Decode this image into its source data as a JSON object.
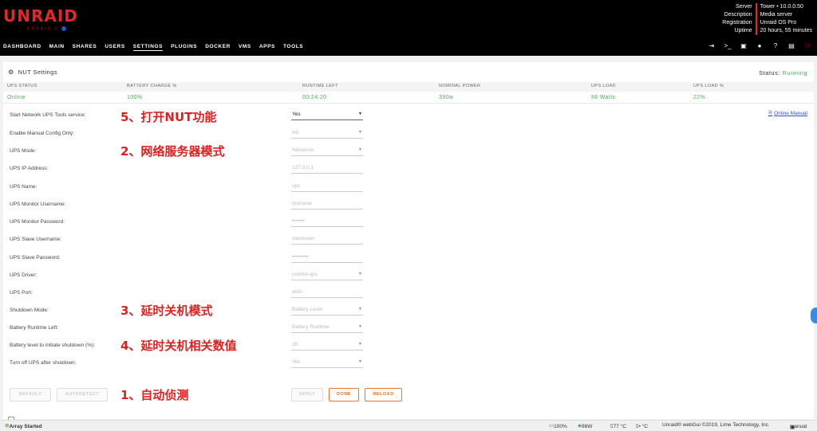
{
  "header": {
    "logo": "UNRAID",
    "logo_sub": "UNRAID O",
    "server_info": [
      {
        "key": "Server",
        "value": "Tower • 10.0.0.50"
      },
      {
        "key": "Description",
        "value": "Media server"
      },
      {
        "key": "Registration",
        "value": "Unraid OS Pro"
      },
      {
        "key": "Uptime",
        "value": "20 hours, 55 minutes"
      }
    ],
    "nav": [
      "DASHBOARD",
      "MAIN",
      "SHARES",
      "USERS",
      "SETTINGS",
      "PLUGINS",
      "DOCKER",
      "VMS",
      "APPS",
      "TOOLS"
    ],
    "nav_active": "SETTINGS",
    "icons": [
      "logout-icon",
      "terminal-icon",
      "feedback-icon",
      "info-icon",
      "help-icon",
      "log-icon",
      "power-icon"
    ]
  },
  "panel": {
    "title": "NUT Settings",
    "status_label": "Status:",
    "status_value": "Running",
    "ups_headers": [
      "UPS STATUS",
      "BATTERY CHARGE %",
      "RUNTIME LEFT",
      "NOMINAL POWER",
      "UPS LOAD",
      "UPS LOAD %"
    ],
    "ups_values": [
      "Online",
      "100%",
      "00:24:20",
      "390w",
      "86 Watts",
      "22%"
    ],
    "online_manual": "Online Manual",
    "fields": [
      {
        "label": "Start Network UPS Tools service:",
        "value": "Yes",
        "type": "select",
        "active": true
      },
      {
        "label": "Enable Manual Config Only:",
        "value": "No",
        "type": "select",
        "active": false
      },
      {
        "label": "UPS Mode:",
        "value": "Netserver",
        "type": "select",
        "active": false
      },
      {
        "label": "UPS IP Address:",
        "value": "127.0.0.1",
        "type": "input",
        "active": false
      },
      {
        "label": "UPS Name:",
        "value": "ups",
        "type": "input",
        "active": false
      },
      {
        "label": "UPS Monitor Username:",
        "value": "monuser",
        "type": "input",
        "active": false
      },
      {
        "label": "UPS Monitor Password:",
        "value": "•••••••",
        "type": "input",
        "active": false
      },
      {
        "label": "UPS Slave Username:",
        "value": "slaveuser",
        "type": "input",
        "active": false
      },
      {
        "label": "UPS Slave Password:",
        "value": "•••••••••",
        "type": "input",
        "active": false
      },
      {
        "label": "UPS Driver:",
        "value": "usbhid-ups",
        "type": "select",
        "active": false
      },
      {
        "label": "UPS Port:",
        "value": "auto",
        "type": "input",
        "active": false
      },
      {
        "label": "Shutdown Mode:",
        "value": "Battery Level",
        "type": "select",
        "active": false
      },
      {
        "label": "Battery Runtime Left:",
        "value": "Battery Runtime",
        "type": "select",
        "active": false
      },
      {
        "label": "Battery level to initiate shutdown (%):",
        "value": "35",
        "type": "select",
        "active": false
      },
      {
        "label": "Turn off UPS after shutdown:",
        "value": "Yes",
        "type": "select",
        "active": false
      }
    ],
    "annotations": [
      "5、打开NUT功能",
      "2、网络服务器模式",
      "3、延时关机模式",
      "4、延时关机相关数值",
      "1、自动侦测"
    ],
    "buttons": {
      "default": "DEFAULT",
      "autodetect": "AUTODETECT",
      "apply": "APPLY",
      "done": "DONE",
      "reload": "RELOAD"
    }
  },
  "footer": {
    "array_status": "Array Started",
    "battery": "100%",
    "watts": "86W",
    "temp1": "77 °C",
    "temp2": "• °C",
    "copyright": "Unraid® webGui ©2019, Lime Technology, Inc.",
    "manual": "manual"
  },
  "colors": {
    "accent": "#e22828",
    "status_green": "#4caf50",
    "annotation_red": "#e02020",
    "button_orange": "#e8752f",
    "link_blue": "#3050c8"
  }
}
